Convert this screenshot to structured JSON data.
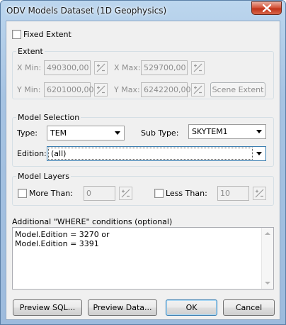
{
  "window": {
    "title": "ODV Models Dataset (1D Geophysics)"
  },
  "fixed_extent": {
    "label": "Fixed Extent",
    "checked": false
  },
  "extent": {
    "title": "Extent",
    "x_min_label": "X Min:",
    "x_min_value": "490300,00",
    "x_max_label": "X Max:",
    "x_max_value": "529700,00",
    "y_min_label": "Y Min:",
    "y_min_value": "6201000,00",
    "y_max_label": "Y Max:",
    "y_max_value": "6242200,00",
    "scene_extent_label": "Scene Extent"
  },
  "model_selection": {
    "title": "Model Selection",
    "type_label": "Type:",
    "type_value": "TEM",
    "subtype_label": "Sub Type:",
    "subtype_value": "SKYTEM1",
    "edition_label": "Edition:",
    "edition_value": "(all)"
  },
  "model_layers": {
    "title": "Model Layers",
    "more_than_label": "More Than:",
    "more_than_value": "0",
    "more_than_checked": false,
    "less_than_label": "Less Than:",
    "less_than_value": "10",
    "less_than_checked": false
  },
  "where": {
    "label": "Additional \"WHERE\" conditions (optional)",
    "text": "Model.Edition = 3270 or\nModel.Edition = 3391"
  },
  "buttons": {
    "preview_sql": "Preview SQL...",
    "preview_data": "Preview Data...",
    "ok": "OK",
    "cancel": "Cancel"
  }
}
